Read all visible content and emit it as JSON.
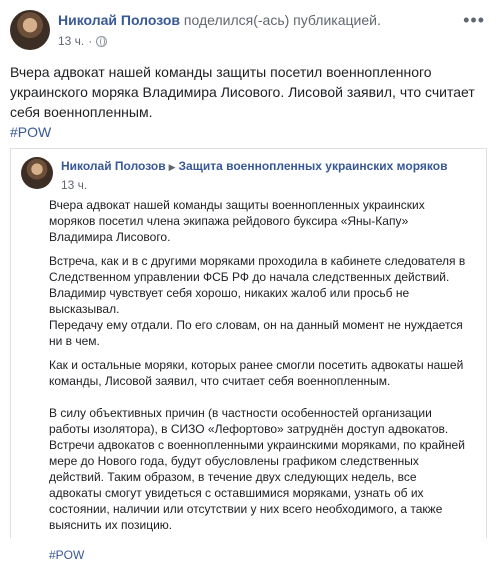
{
  "header": {
    "author": "Николай Полозов",
    "action": " поделился(-ась) публикацией.",
    "time": "13 ч.",
    "more_icon": "more-dots-icon"
  },
  "post": {
    "text": "Вчера адвокат нашей команды защиты посетил военнопленного украинского моряка Владимира Лисового. Лисовой заявил, что считает себя военнопленным.",
    "hashtag": "#POW"
  },
  "shared": {
    "author": "Николай Полозов",
    "group": "Защита военнопленных украинских моряков",
    "time": "13 ч.",
    "paragraphs": [
      "Вчера адвокат нашей команды защиты военнопленных украинских моряков посетил члена экипажа рейдового буксира «Яны-Капу» Владимира Лисового.",
      "Встреча, как и в с другими моряками проходила в кабинете следователя в Следственном управлении ФСБ РФ до начала следственных действий.",
      "Владимир чувствует себя хорошо, никаких жалоб или просьб не высказывал.",
      "Передачу ему отдали. По его словам, он на данный момент не нуждается ни в чем.",
      "Как и остальные моряки, которых ранее смогли посетить адвокаты нашей команды, Лисовой заявил, что считает себя военнопленным.",
      "В силу объективных причин (в частности особенностей организации работы изолятора), в СИЗО «Лефортово» затруднён доступ адвокатов. Встречи адвокатов с военнопленными украинскими моряками, по крайней мере до Нового года, будут обусловлены графиком следственных действий. Таким образом, в течение двух следующих недель, все адвокаты смогут увидеться с оставшимися моряками, узнать об их состоянии, наличии или отсутствии у них всего необходимого, а также выяснить их позицию."
    ],
    "hashtag": "#POW"
  }
}
